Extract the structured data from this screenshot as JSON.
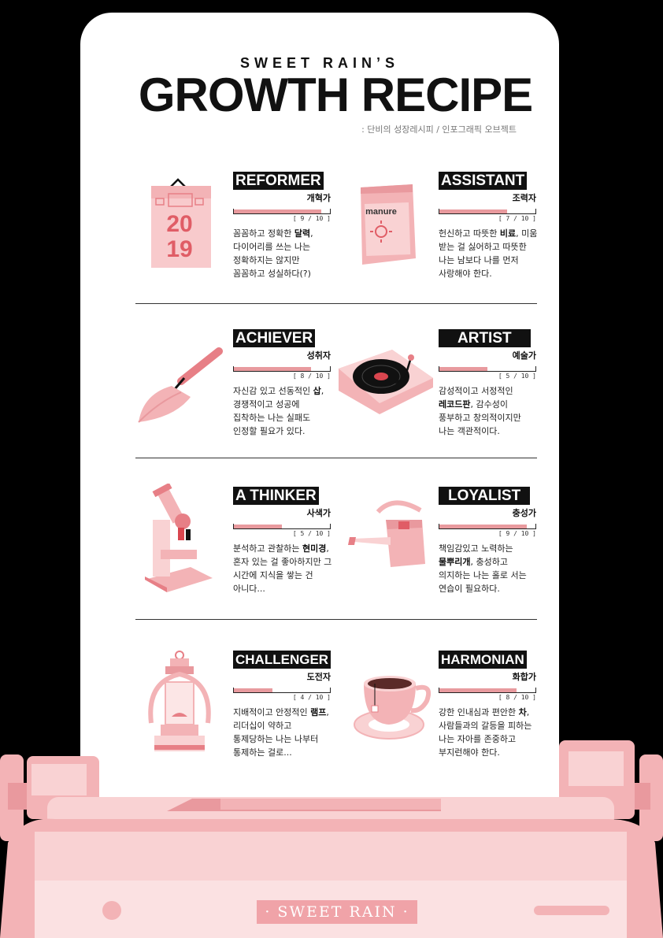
{
  "header": {
    "kicker": "SWEET RAIN’S",
    "title": "GROWTH RECIPE",
    "tagline": ": 단비의 성장레시피 / 인포그래픽 오브젝트"
  },
  "entries": [
    {
      "name": "REFORMER",
      "role": "개혁가",
      "score": 9,
      "score_label": "[ 9 / 10 ]",
      "desc_pre": "꼼꼼하고 정확한 ",
      "desc_bold": "달력",
      "desc_post": ", 다이어리를 쓰는 나는 정확하지는 않지만 꼼꼼하고 성실하다(?)",
      "icon": "calendar-icon"
    },
    {
      "name": "ASSISTANT",
      "role": "조력자",
      "score": 7,
      "score_label": "[ 7 / 10 ]",
      "desc_pre": "헌신하고 따뜻한 ",
      "desc_bold": "비료",
      "desc_post": ", 미움 받는 걸 싫어하고 따뜻한 나는 남보다 나를 먼저 사랑해야 한다.",
      "icon": "fertilizer-bag-icon"
    },
    {
      "name": "ACHIEVER",
      "role": "성취자",
      "score": 8,
      "score_label": "[ 8 / 10 ]",
      "desc_pre": "자신감 있고 선동적인 ",
      "desc_bold": "삽",
      "desc_post": ", 경쟁적이고 성공에 집착하는 나는 실패도 인정할 필요가 있다.",
      "icon": "trowel-icon"
    },
    {
      "name": "ARTIST",
      "role": "예술가",
      "score": 5,
      "score_label": "[ 5 / 10 ]",
      "desc_pre": "감성적이고 서정적인 ",
      "desc_bold": "레코드판",
      "desc_post": ", 감수성이 풍부하고 창의적이지만 나는 객관적이다.",
      "icon": "record-player-icon"
    },
    {
      "name": "A THINKER",
      "role": "사색가",
      "score": 5,
      "score_label": "[ 5 / 10 ]",
      "desc_pre": "분석하고 관찰하는 ",
      "desc_bold": "현미경",
      "desc_post": ", 혼자 있는 걸 좋아하지만 그 시간에 지식을 쌓는 건 아니다...",
      "icon": "microscope-icon"
    },
    {
      "name": "LOYALIST",
      "role": "충성가",
      "score": 9,
      "score_label": "[ 9 / 10 ]",
      "desc_pre": "책임감있고 노력하는 ",
      "desc_bold": "물뿌리개",
      "desc_post": ", 충성하고 의지하는 나는 홀로 서는 연습이 필요하다.",
      "icon": "watering-can-icon"
    },
    {
      "name": "CHALLENGER",
      "role": "도전자",
      "score": 4,
      "score_label": "[ 4 / 10 ]",
      "desc_pre": "지배적이고 안정적인 ",
      "desc_bold": "램프",
      "desc_post": ", 리더십이 약하고 통제당하는 나는 나부터 통제하는 걸로...",
      "icon": "lantern-icon"
    },
    {
      "name": "HARMONIAN",
      "role": "화합가",
      "score": 8,
      "score_label": "[ 8 / 10 ]",
      "desc_pre": "강한 인내심과 편안한 ",
      "desc_bold": "차",
      "desc_post": ", 사람들과의 갈등을 피하는 나는 자아를 존중하고 부지런해야 한다.",
      "icon": "teacup-icon"
    }
  ],
  "calendar": {
    "year_top": "20",
    "year_bottom": "19"
  },
  "fertilizer": {
    "label": "manure"
  },
  "brand": "· SWEET RAIN ·",
  "colors": {
    "pink": "#f3b3b6",
    "pink_light": "#f9d2d3",
    "pink_dark": "#e77f86",
    "red": "#d9464f"
  }
}
